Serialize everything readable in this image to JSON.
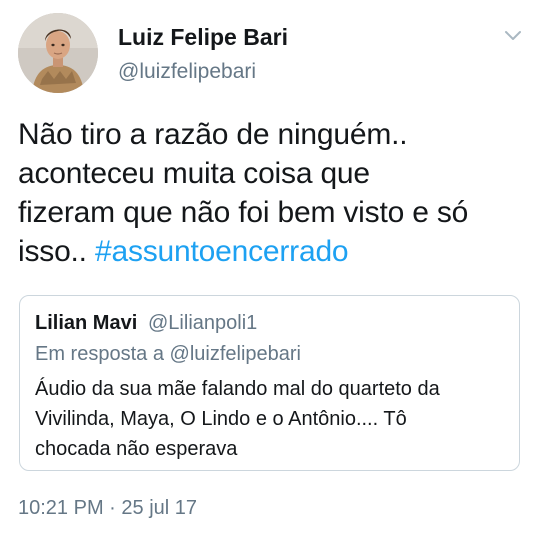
{
  "author": {
    "display_name": "Luiz Felipe Bari",
    "handle": "@luizfelipebari"
  },
  "tweet": {
    "lines": [
      "Não tiro a razão de ninguém..",
      "aconteceu muita coisa que",
      "fizeram que não foi bem visto e só"
    ],
    "last_line_prefix": "isso.. ",
    "hashtag": "#assuntoencerrado"
  },
  "quoted": {
    "display_name": "Lilian Mavi",
    "handle": "@Lilianpoli1",
    "reply_prefix": "Em resposta a ",
    "reply_to": "@luizfelipebari",
    "lines": [
      "Áudio da sua mãe falando mal do quarteto da",
      "Vivilinda, Maya, O Lindo e o Antônio.... Tô",
      "chocada não esperava"
    ]
  },
  "timestamp": {
    "time": "10:21 PM",
    "separator": " · ",
    "date": "25 jul 17"
  },
  "icons": {
    "avatar": "user-avatar-photo",
    "menu": "chevron-down-icon"
  },
  "colors": {
    "text": "#14171a",
    "secondary": "#657786",
    "link": "#1da1f2",
    "border": "#ccd6dd"
  }
}
